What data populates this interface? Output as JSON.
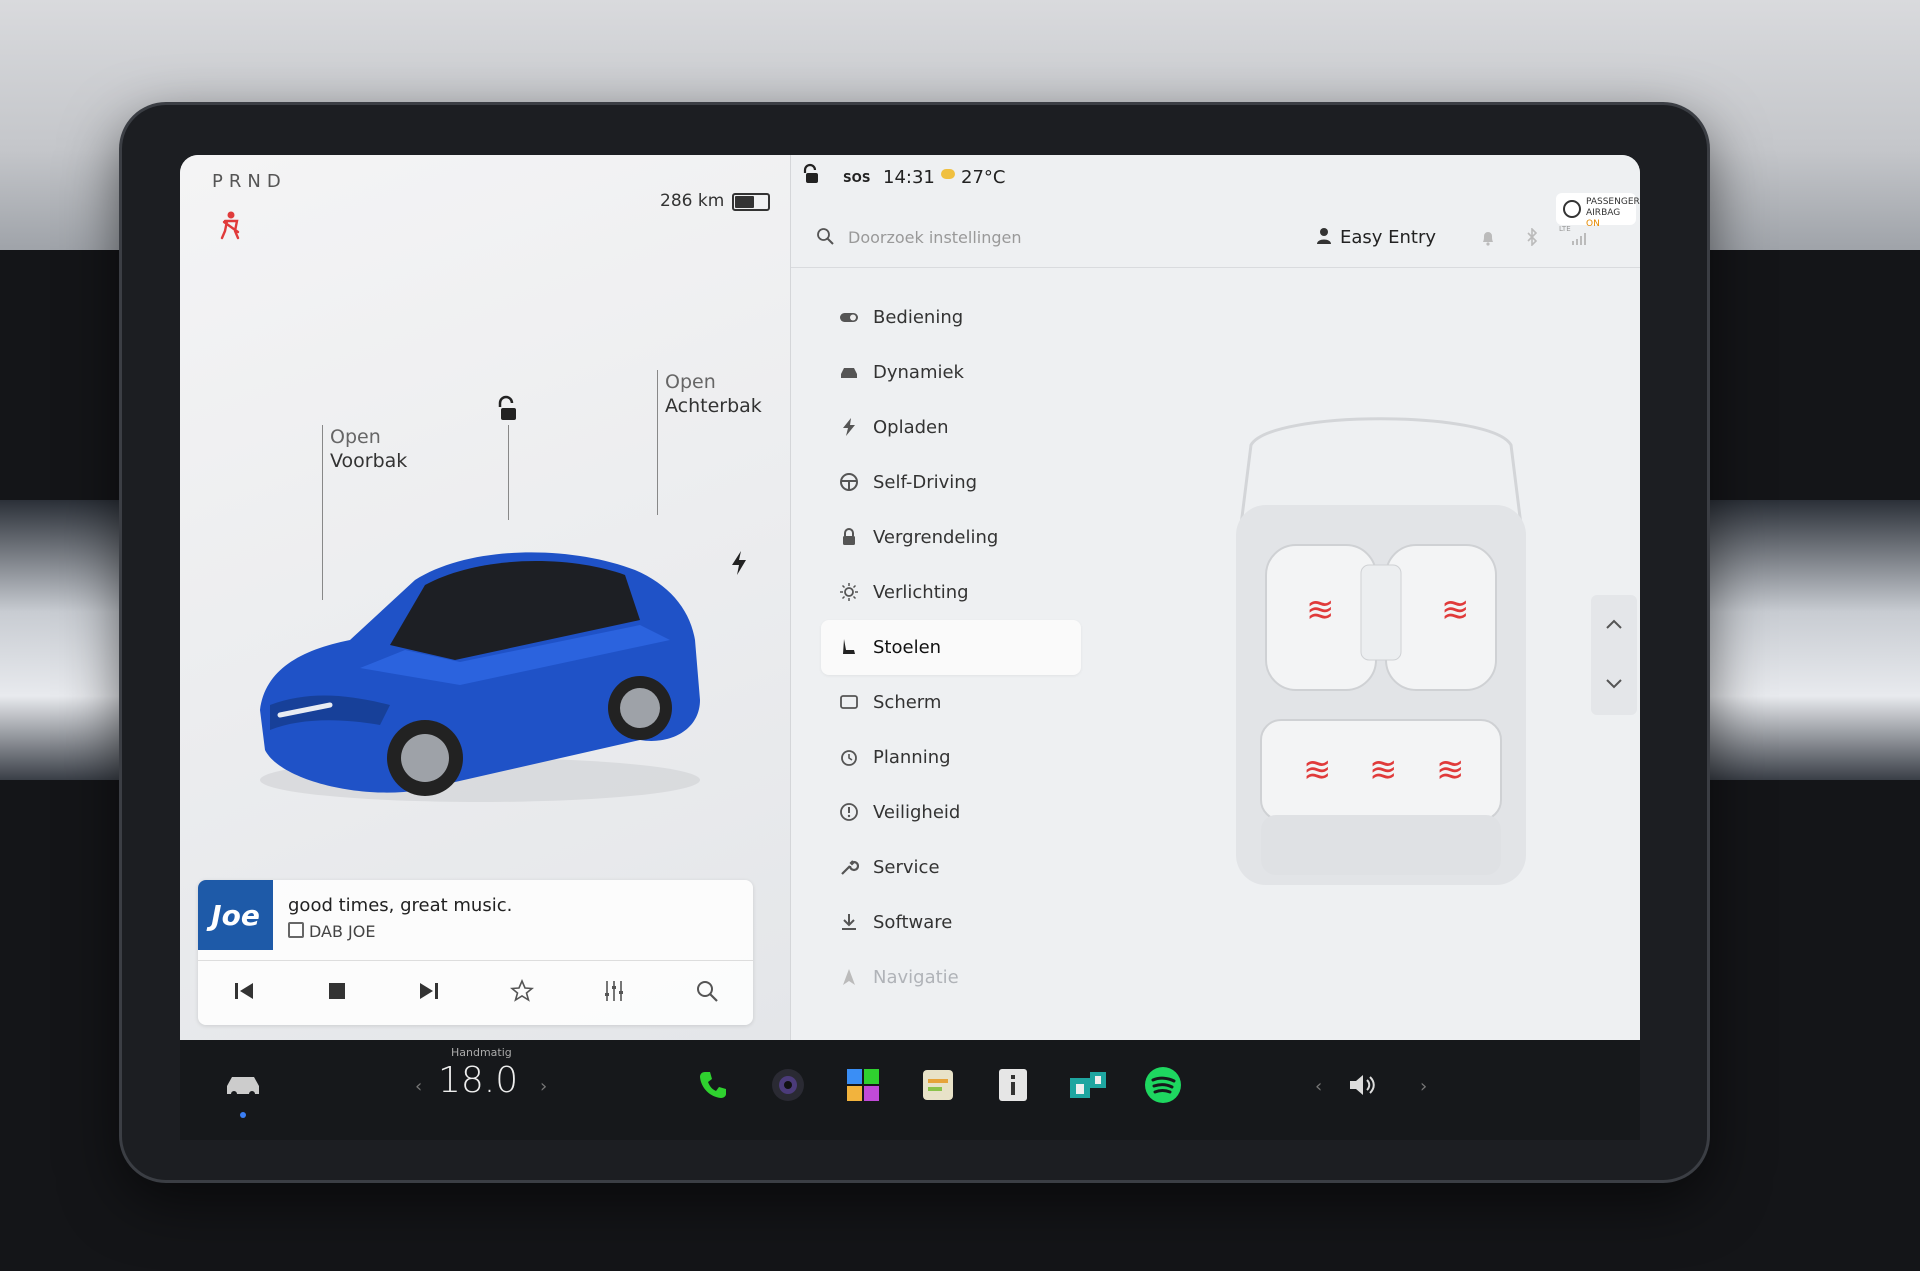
{
  "drive": {
    "gear_selector": "PRND",
    "range": "286 km",
    "battery_level": 0.6,
    "frunk_callout": {
      "action": "Open",
      "label": "Voorbak"
    },
    "trunk_callout": {
      "action": "Open",
      "label": "Achterbak"
    }
  },
  "media": {
    "station_logo": "Joe",
    "track_title": "good times, great music.",
    "station_name": "DAB JOE"
  },
  "status_bar": {
    "sos": "SOS",
    "time": "14:31",
    "temperature": "27°C",
    "airbag_line1": "PASSENGER",
    "airbag_line2": "AIRBAG",
    "airbag_state": "ON"
  },
  "settings": {
    "search_placeholder": "Doorzoek instellingen",
    "profile_name": "Easy Entry",
    "lte_label": "LTE",
    "menu": [
      {
        "label": "Bediening",
        "icon": "toggle-icon"
      },
      {
        "label": "Dynamiek",
        "icon": "car-icon"
      },
      {
        "label": "Opladen",
        "icon": "bolt-icon"
      },
      {
        "label": "Self-Driving",
        "icon": "steering-wheel-icon"
      },
      {
        "label": "Vergrendeling",
        "icon": "lock-icon"
      },
      {
        "label": "Verlichting",
        "icon": "sun-icon"
      },
      {
        "label": "Stoelen",
        "icon": "seat-icon",
        "active": true
      },
      {
        "label": "Scherm",
        "icon": "screen-icon"
      },
      {
        "label": "Planning",
        "icon": "alarm-icon"
      },
      {
        "label": "Veiligheid",
        "icon": "alert-icon"
      },
      {
        "label": "Service",
        "icon": "wrench-icon"
      },
      {
        "label": "Software",
        "icon": "download-icon"
      },
      {
        "label": "Navigatie",
        "icon": "nav-icon"
      }
    ]
  },
  "climate": {
    "mode_label": "Handmatig",
    "temperature": "18.0"
  },
  "colors": {
    "accent_red": "#e03a3a",
    "car_blue": "#1f52c7",
    "spotify_green": "#1ed760",
    "phone_green": "#2fd12f"
  }
}
